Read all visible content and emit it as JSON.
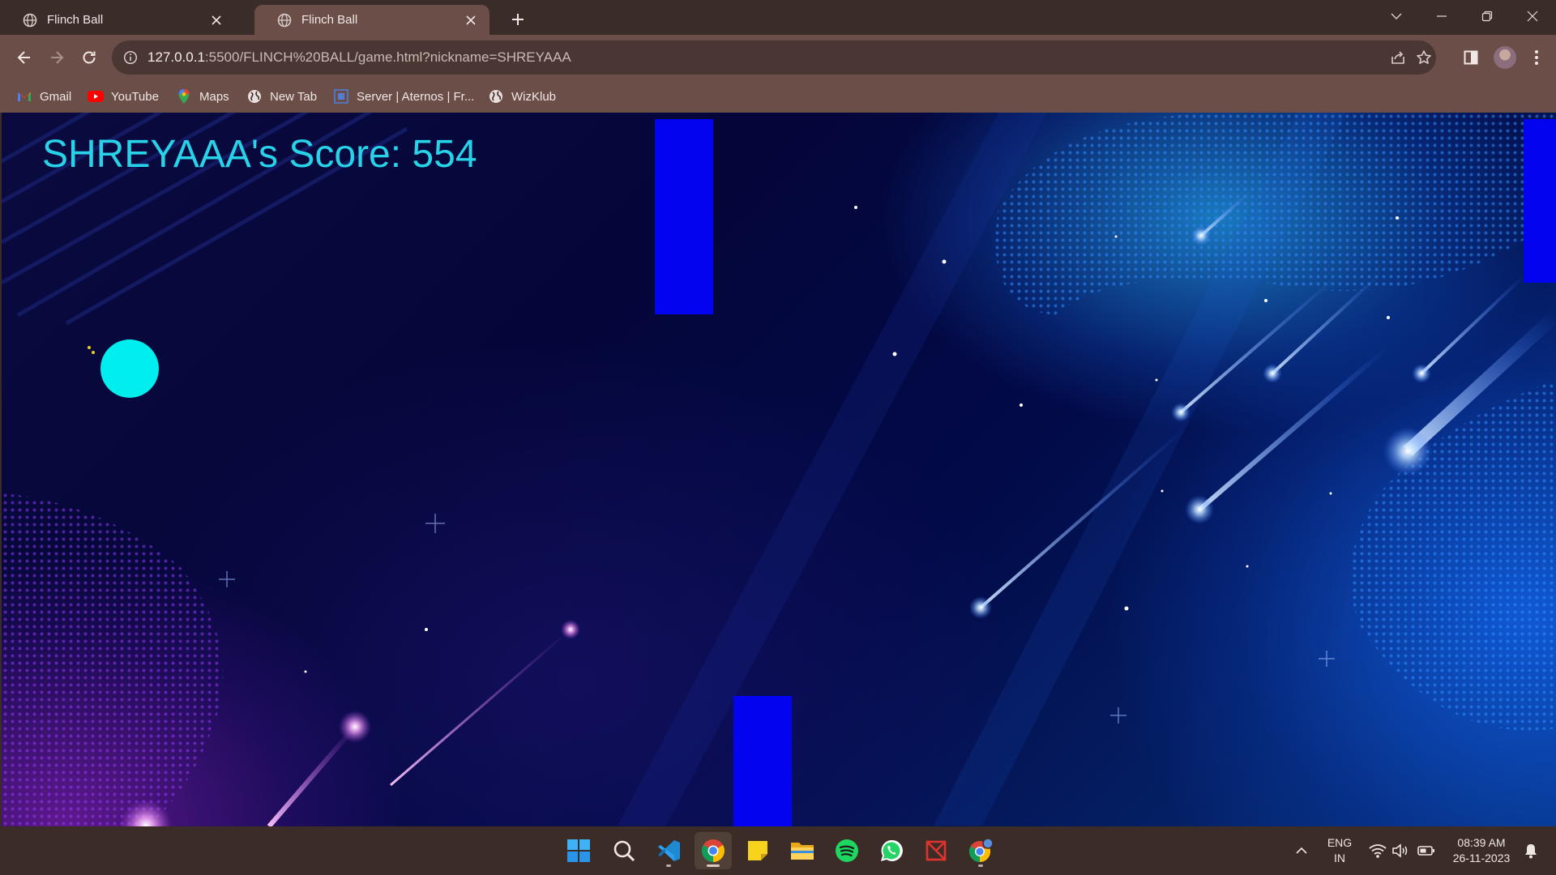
{
  "tabs": [
    {
      "title": "Flinch Ball",
      "active": false
    },
    {
      "title": "Flinch Ball",
      "active": true
    }
  ],
  "toolbar": {
    "url_host": "127.0.0.1",
    "url_rest": ":5500/FLINCH%20BALL/game.html?nickname=SHREYAAA"
  },
  "bookmarks": [
    {
      "label": "Gmail",
      "icon": "gmail-icon"
    },
    {
      "label": "YouTube",
      "icon": "youtube-icon"
    },
    {
      "label": "Maps",
      "icon": "maps-icon"
    },
    {
      "label": "New Tab",
      "icon": "globe-icon"
    },
    {
      "label": "Server | Aternos | Fr...",
      "icon": "aternos-icon"
    },
    {
      "label": "WizKlub",
      "icon": "globe-icon"
    }
  ],
  "game": {
    "score_text": "SHREYAAA's Score: 554"
  },
  "taskbar": {
    "apps": [
      "start-icon",
      "search-icon",
      "vscode-icon",
      "chrome-icon",
      "sticky-notes-icon",
      "file-explorer-icon",
      "spotify-icon",
      "whatsapp-icon",
      "app-icon",
      "chrome-profile-icon"
    ],
    "language": "ENG",
    "region": "IN",
    "time": "08:39 AM",
    "date": "26-11-2023"
  },
  "colors": {
    "score_text": "#27d3e9",
    "ball": "#00eeee",
    "pipe": "#0303f0",
    "browser_frame": "#3a2c29",
    "toolbar": "#6b4e48"
  }
}
